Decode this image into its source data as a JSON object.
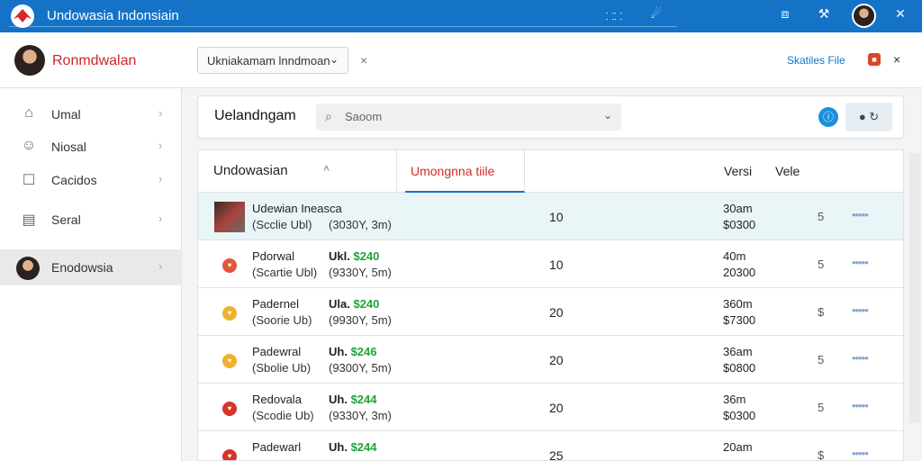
{
  "titlebar": {
    "app_title": "Undowasia Indonsiain",
    "icon1": "⸬⸬",
    "icon2": "☄",
    "window_button": "⧈",
    "pin_icon": "⚒"
  },
  "toolbar": {
    "brand": "Ronmdwalan",
    "select_value": "Ukniakamam lnndmoan",
    "select_chevron": "⌄",
    "close1": "×",
    "link": "Skatiles File",
    "red_icon": "■",
    "close2": "×"
  },
  "sidebar": {
    "items": [
      {
        "label": "Umal",
        "icon": "⌂",
        "chevron": "›"
      },
      {
        "label": "Niosal",
        "icon": "☺",
        "chevron": "›"
      },
      {
        "label": "Cacidos",
        "icon": "☐",
        "chevron": "›"
      },
      {
        "label": "Seral",
        "icon": "▤",
        "chevron": "›"
      },
      {
        "label": "Enodowsia",
        "icon": "",
        "chevron": "›"
      }
    ]
  },
  "search": {
    "heading": "Uelandngam",
    "placeholder": "Saoom",
    "search_icon": "⌕",
    "dropdown_chevron": "⌄",
    "info_icon": "ⓘ",
    "actions": "● ↻"
  },
  "table": {
    "headers": {
      "col1": "Undowasian",
      "sort": "˄",
      "tab": "Umongnna tiile",
      "col3": "Versi",
      "col4": "Vele"
    },
    "rows": [
      {
        "name": "Udewian Ineasca",
        "sub": "(Scclie Ubl)",
        "sub2": "(3030Y, 3m)",
        "tag1": "",
        "tag2": "",
        "qty": "10",
        "v1": "30am",
        "v2": "$0300",
        "v3": "5",
        "dots": "•••••",
        "icon_color": "",
        "selected": true
      },
      {
        "name": "Pdorwal",
        "sub": "(Scartie Ubl)",
        "sub2": "(9330Y, 5m)",
        "tag1": "Ukl.",
        "tag2": "$240",
        "qty": "10",
        "v1": "40m",
        "v2": "20300",
        "v3": "5",
        "dots": "•••••",
        "icon_color": "#e4553a",
        "selected": false
      },
      {
        "name": "Padernel",
        "sub": "(Soorie Ub)",
        "sub2": "(9930Y, 5m)",
        "tag1": "Ula.",
        "tag2": "$240",
        "qty": "20",
        "v1": "360m",
        "v2": "$7300",
        "v3": "$",
        "dots": "•••••",
        "icon_color": "#f1b02c",
        "selected": false
      },
      {
        "name": "Padewral",
        "sub": "(Sbolie Ub)",
        "sub2": "(9300Y, 5m)",
        "tag1": "Uh.",
        "tag2": "$246",
        "qty": "20",
        "v1": "36am",
        "v2": "$0800",
        "v3": "5",
        "dots": "•••••",
        "icon_color": "#f1b02c",
        "selected": false
      },
      {
        "name": "Redovala",
        "sub": "(Scodie Ub)",
        "sub2": "(9330Y, 3m)",
        "tag1": "Uh.",
        "tag2": "$244",
        "qty": "20",
        "v1": "36m",
        "v2": "$0300",
        "v3": "5",
        "dots": "•••••",
        "icon_color": "#d7322b",
        "selected": false
      },
      {
        "name": "Padewarl",
        "sub": "",
        "sub2": "",
        "tag1": "Uh.",
        "tag2": "$244",
        "qty": "25",
        "v1": "20am",
        "v2": "",
        "v3": "$",
        "dots": "•••••",
        "icon_color": "#d7322b",
        "selected": false
      }
    ]
  },
  "colors": {
    "accent": "#1473c7",
    "brand_red": "#c8282c",
    "selected_row": "#e9f5f6",
    "tag_green": "#1ea33a"
  }
}
